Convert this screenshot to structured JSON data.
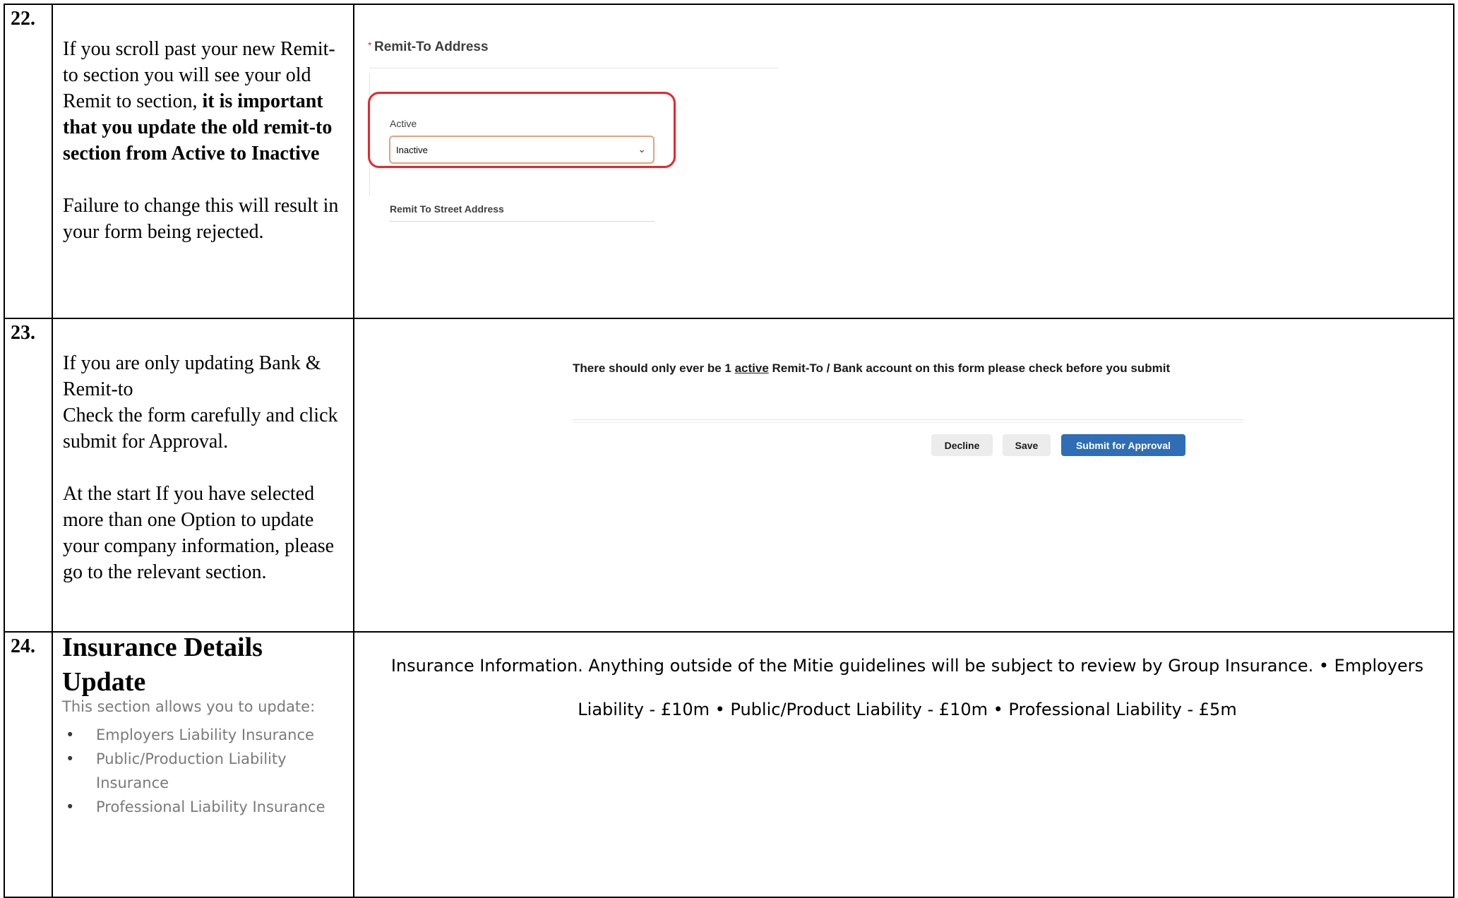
{
  "rows": [
    {
      "number": "22.",
      "text_a": "If you scroll past your new Remit-to section you will see your old Remit to section, ",
      "text_bold": "it is important that you update the old remit-to section from Active to Inactive",
      "text_b": "Failure to change this will result in your form being rejected."
    },
    {
      "number": "23.",
      "text_a": "If you are only updating Bank & Remit-to",
      "text_b": "Check the form carefully and click submit for Approval.",
      "text_c": "At the start If you have selected more than one Option to update your company information, please go to the relevant section."
    },
    {
      "number": "24.",
      "title": "Insurance Details Update",
      "subtitle": "This section allows you to update:",
      "items": [
        "Employers Liability Insurance",
        "Public/Production Liability Insurance",
        "Professional Liability Insurance"
      ]
    }
  ],
  "remit_form": {
    "required_marker": "*",
    "section_title": "Remit-To Address",
    "active_label": "Active",
    "active_value": "Inactive",
    "street_label": "Remit To Street Address",
    "highlight_color": "#e8262b"
  },
  "approval": {
    "notice_pre": "There should only ever be 1 ",
    "notice_underlined": "active",
    "notice_post": " Remit-To / Bank account on this form please check before you submit",
    "decline_label": "Decline",
    "save_label": "Save",
    "submit_label": "Submit for Approval",
    "submit_color": "#2f6db6"
  },
  "insurance_info": "Insurance Information. Anything outside of the Mitie guidelines will be subject to review by Group Insurance. • Employers Liability - £10m • Public/Product Liability - £10m • Professional Liability - £5m"
}
